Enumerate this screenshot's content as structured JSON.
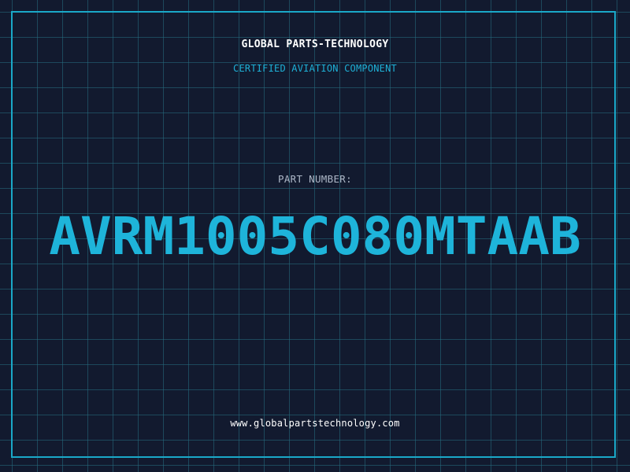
{
  "header": {
    "company": "GLOBAL PARTS-TECHNOLOGY",
    "subtitle": "CERTIFIED AVIATION COMPONENT"
  },
  "part": {
    "label": "PART NUMBER:",
    "number": "AVRM1005C080MTAAB"
  },
  "footer": {
    "website": "www.globalpartstechnology.com"
  },
  "colors": {
    "background": "#121a2f",
    "grid": "#266e82",
    "accent": "#1eb4da",
    "frame": "#1aa8c8",
    "label": "#aeb8c8",
    "text": "#ffffff"
  }
}
